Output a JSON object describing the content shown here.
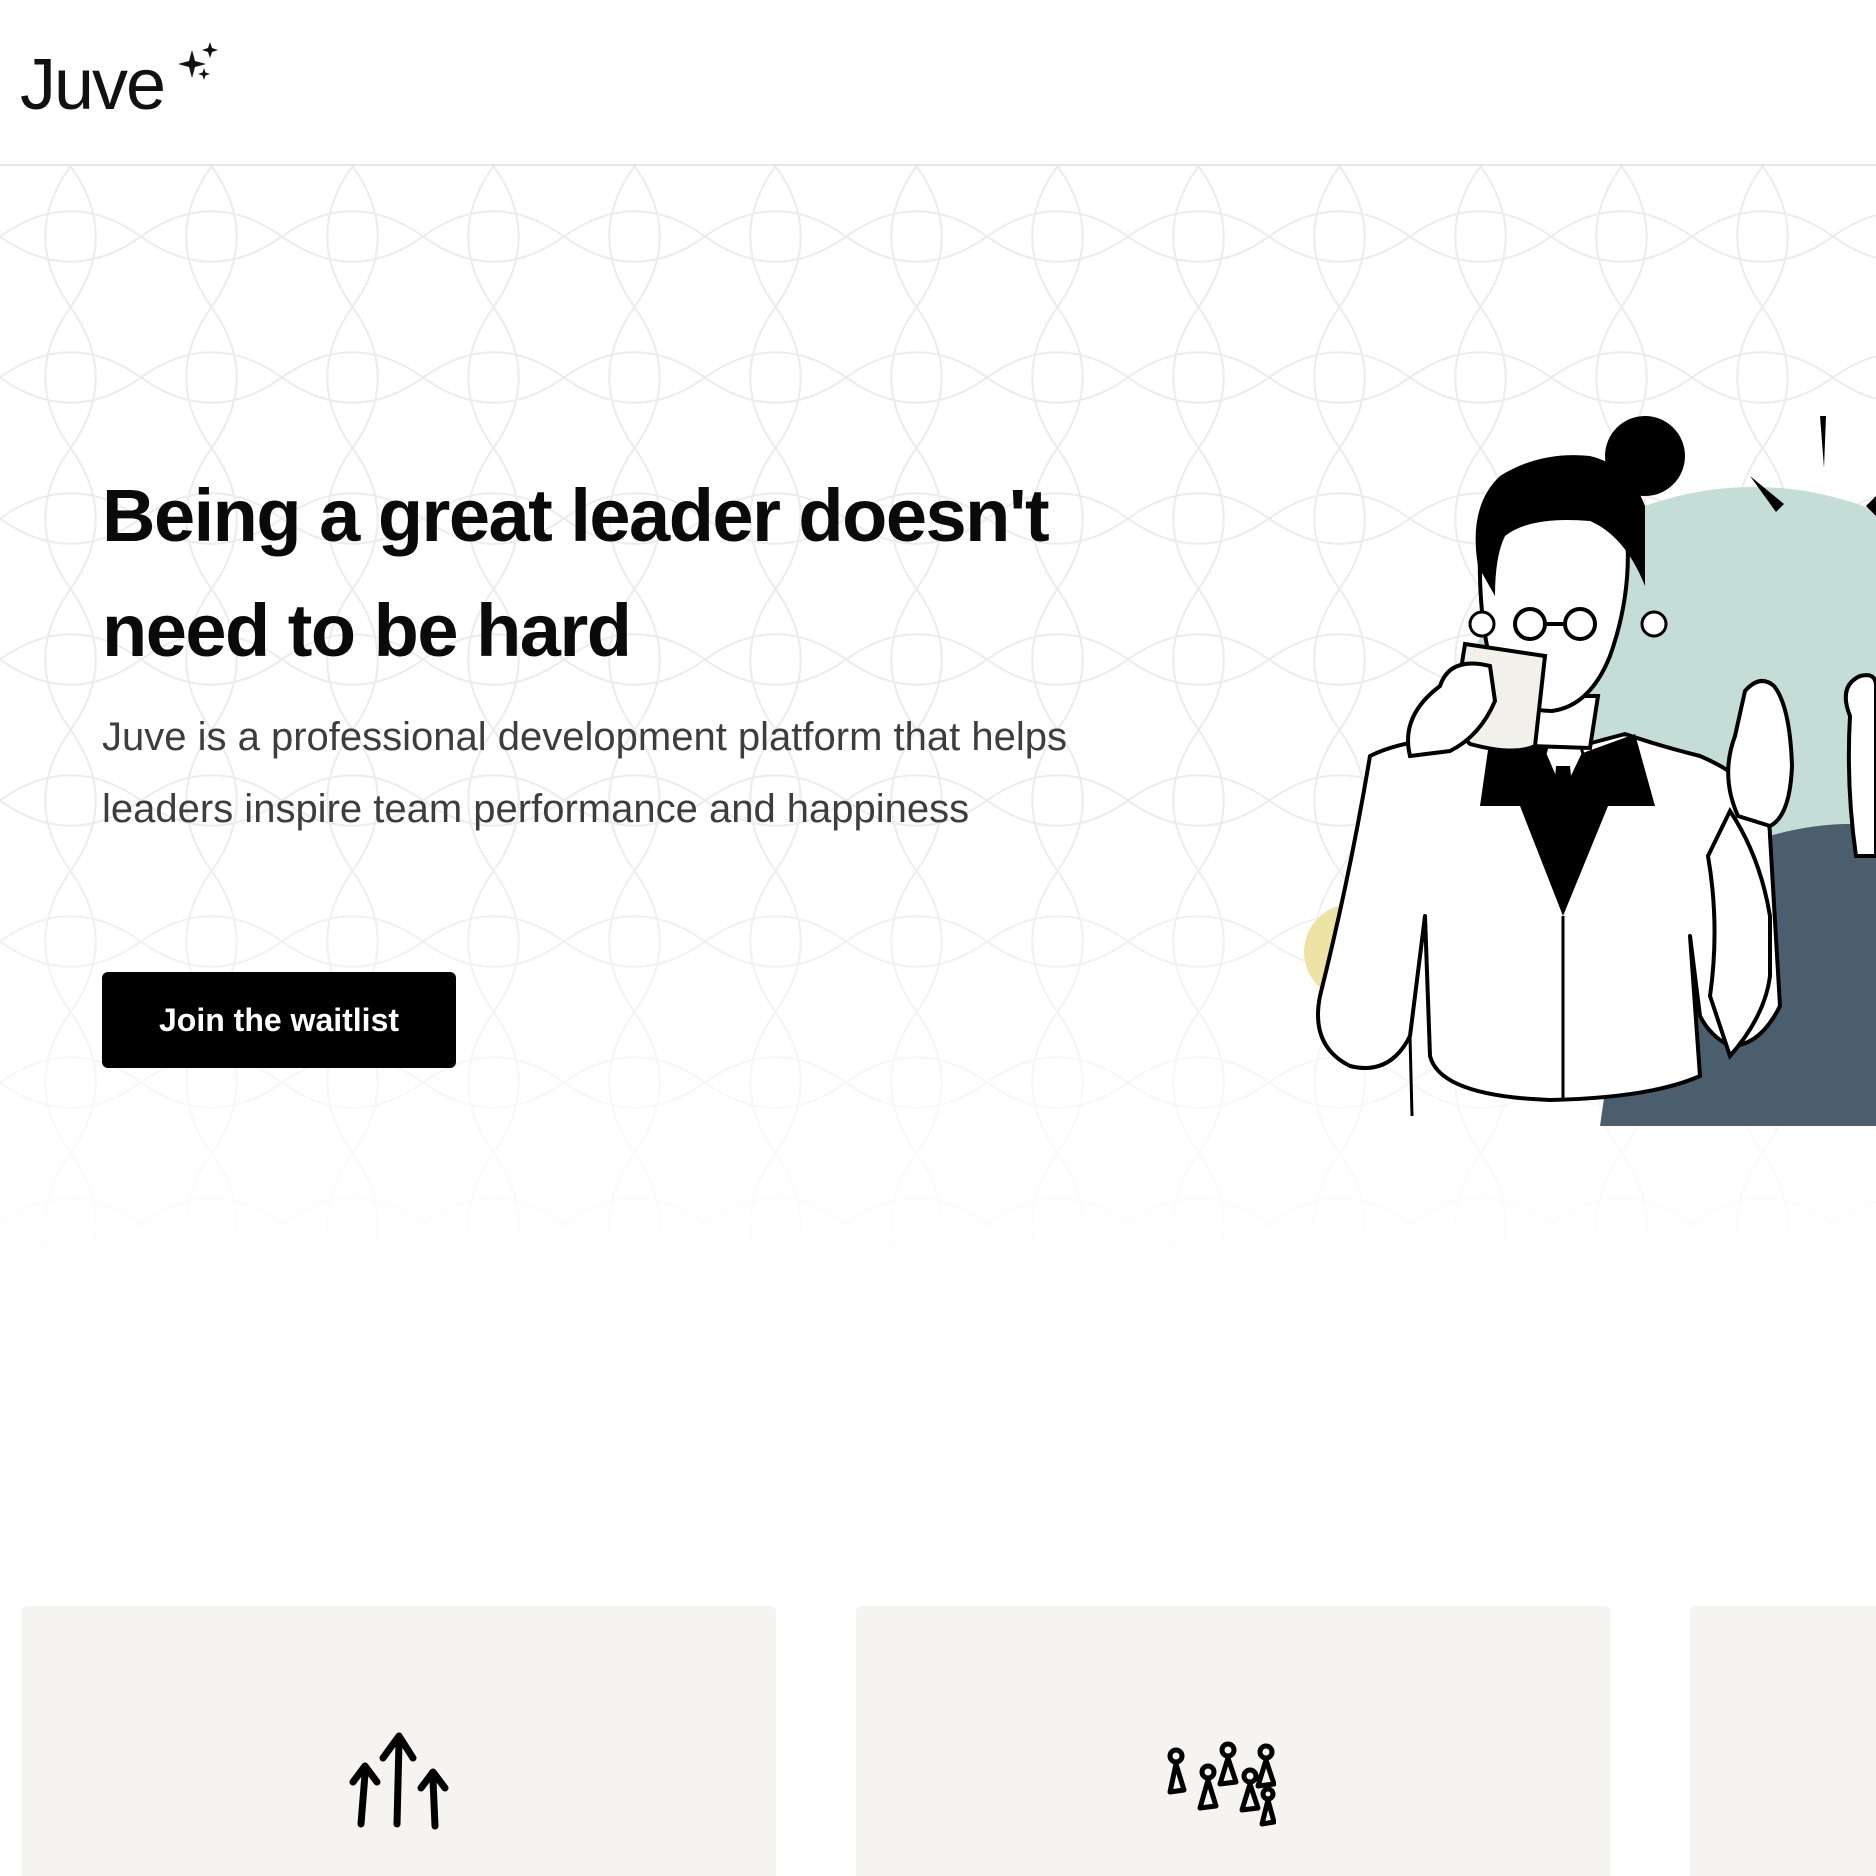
{
  "header": {
    "logo_text": "Juve"
  },
  "hero": {
    "title": "Being a great leader doesn't need to be hard",
    "subtitle": "Juve is a professional development platform that helps leaders inspire team performance and happiness",
    "cta_label": "Join the waitlist"
  },
  "colors": {
    "accent_black": "#000000",
    "mint": "#c5ddd7",
    "slate": "#4a5e6e",
    "butter": "#ece3a4",
    "card_bg": "#f5f4f0"
  },
  "features": {
    "cards": [
      {
        "icon": "growth-arrows-icon"
      },
      {
        "icon": "people-group-icon"
      },
      {
        "icon": "unknown-icon"
      }
    ]
  }
}
